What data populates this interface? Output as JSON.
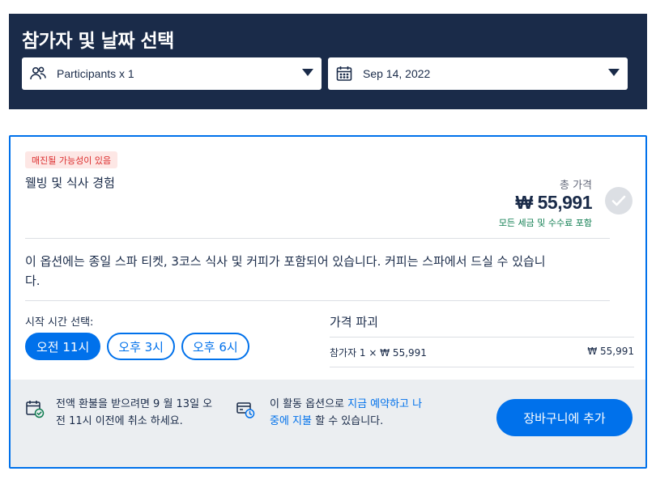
{
  "header": {
    "title": "참가자 및 날짜 선택",
    "participants_label": "Participants x 1",
    "date_label": "Sep 14, 2022"
  },
  "option": {
    "badge": "매진될 가능성이 있음",
    "title": "웰빙 및 식사 경험",
    "total_label": "총 가격",
    "price": "₩ 55,991",
    "price_note": "모든 세금 및 수수료 포함",
    "description": "이 옵션에는 종일 스파 티켓, 3코스 식사 및 커피가 포함되어 있습니다. 커피는 스파에서 드실 수 있습니다."
  },
  "times": {
    "label": "시작 시간 선택:",
    "slots": [
      "오전 11시",
      "오후 3시",
      "오후 6시"
    ],
    "selected_index": 0
  },
  "breakdown": {
    "title": "가격 파괴",
    "row_label": "참가자 1 × ₩ 55,991",
    "row_value": "₩ 55,991"
  },
  "footer": {
    "refund_text": "전액 환불을 받으려면 9 월 13일 오전 11시 이전에 취소 하세요.",
    "reserve_prefix": "이 활동 옵션으로 ",
    "reserve_link": "지금 예약하고 나중에 지불",
    "reserve_suffix": " 할 수 있습니다.",
    "cart_button": "장바구니에 추가"
  },
  "colors": {
    "header_bg": "#1a2b49",
    "accent": "#0071eb",
    "badge_text": "#dc2e2e",
    "badge_bg": "#fde7e5",
    "success": "#0d7c4f"
  },
  "icons": {
    "participants": "people-icon",
    "date": "calendar-icon",
    "selected": "checkmark-icon",
    "refund": "calendar-check-icon",
    "reserve": "credit-card-clock-icon"
  }
}
